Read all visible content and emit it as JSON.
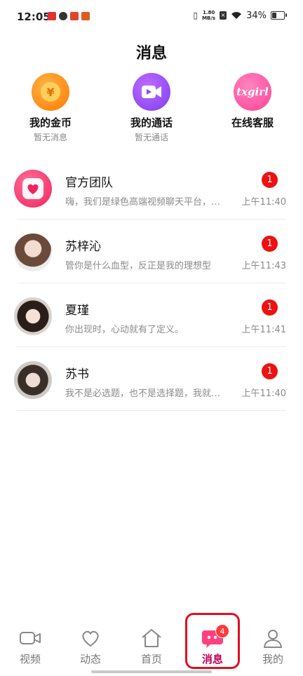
{
  "status_bar": {
    "time": "12:05",
    "speed_value": "1.80",
    "speed_unit": "MB/s",
    "battery": "34%",
    "battery_level": 0.34
  },
  "page_title": "消息",
  "shortcuts": [
    {
      "label": "我的金币",
      "sub": "暂无消息",
      "icon": "coin-icon",
      "glyph": "¥"
    },
    {
      "label": "我的通话",
      "sub": "暂无通话",
      "icon": "video-call-icon"
    },
    {
      "label": "在线客服",
      "sub": "",
      "icon": "customer-service-icon",
      "logo_text": "txgirl"
    }
  ],
  "messages": [
    {
      "name": "官方团队",
      "preview": "嗨，我们是绿色高端视频聊天平台，…",
      "time": "上午11:40",
      "badge": "1"
    },
    {
      "name": "苏梓沁",
      "preview": "管你是什么血型，反正是我的理想型",
      "time": "上午11:43",
      "badge": "1"
    },
    {
      "name": "夏瑾",
      "preview": "你出现时，心动就有了定义。",
      "time": "上午11:41",
      "badge": "1"
    },
    {
      "name": "苏书",
      "preview": "我不是必选题，也不是选择题，我就…",
      "time": "上午11:40",
      "badge": "1"
    }
  ],
  "tabs": [
    {
      "label": "视频",
      "icon": "video-camera-icon"
    },
    {
      "label": "动态",
      "icon": "heart-icon"
    },
    {
      "label": "首页",
      "icon": "home-icon"
    },
    {
      "label": "消息",
      "icon": "chat-bubble-icon",
      "badge": "4",
      "active": true
    },
    {
      "label": "我的",
      "icon": "person-icon"
    }
  ],
  "colors": {
    "accent": "#c0005a",
    "badge_red": "#ee1111",
    "highlight_border": "#e01020"
  }
}
